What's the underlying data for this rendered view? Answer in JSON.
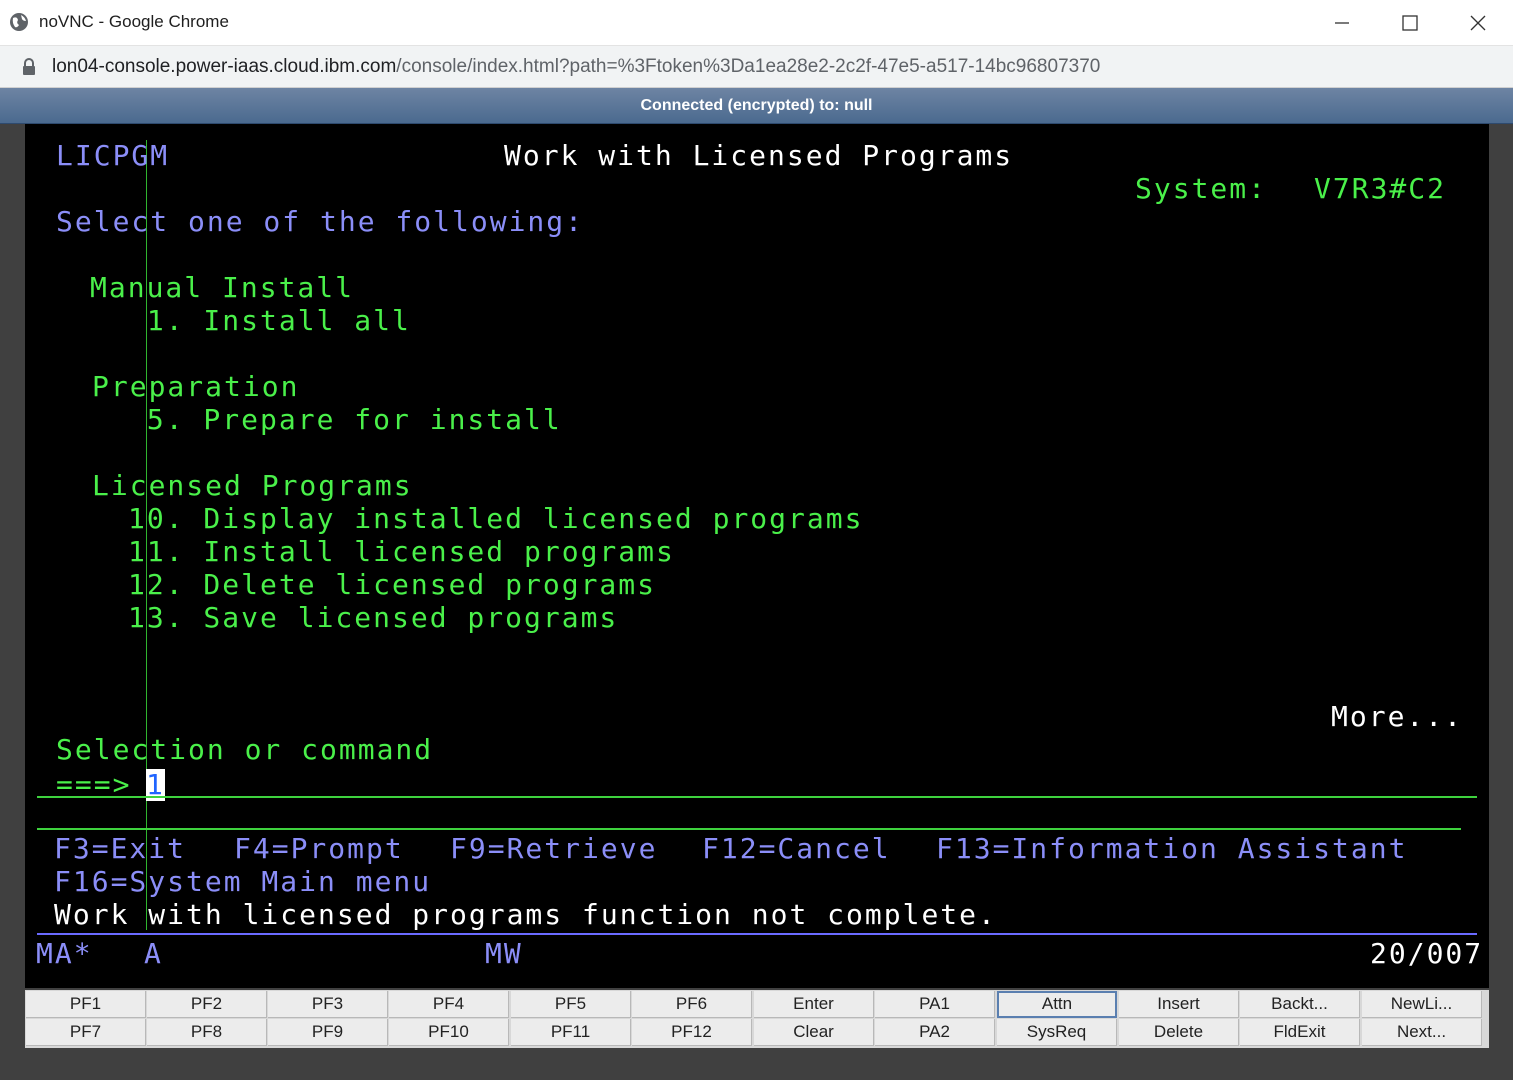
{
  "window": {
    "title": "noVNC - Google Chrome"
  },
  "address": {
    "host": "lon04-console.power-iaas.cloud.ibm.com",
    "path": "/console/index.html?path=%3Ftoken%3Da1ea28e2-2c2f-47e5-a517-14bc96807370"
  },
  "vnc": {
    "status": "Connected (encrypted) to: null"
  },
  "terminal": {
    "program": "LICPGM",
    "title": "Work with Licensed Programs",
    "system_label": "System:",
    "system_value": "V7R3#C2",
    "prompt_header": "Select one of the following:",
    "sections": [
      {
        "heading": "Manual Install",
        "items": [
          " 1. Install all"
        ]
      },
      {
        "heading": "Preparation",
        "items": [
          " 5. Prepare for install"
        ]
      },
      {
        "heading": "Licensed Programs",
        "items": [
          "10. Display installed licensed programs",
          "11. Install licensed programs",
          "12. Delete licensed programs",
          "13. Save licensed programs"
        ]
      }
    ],
    "more": "More...",
    "selection_label": "Selection or command",
    "arrow": "===>",
    "input_value": "1",
    "fkeys_line1": [
      "F3=Exit",
      "F4=Prompt",
      "F9=Retrieve",
      "F12=Cancel",
      "F13=Information Assistant"
    ],
    "fkeys_line2": "F16=System Main menu",
    "message": "Work with licensed programs function not complete.",
    "status": {
      "left": "MA*",
      "a": "A",
      "mid": "MW",
      "right": "20/007"
    }
  },
  "keypad": {
    "row1": [
      "PF1",
      "PF2",
      "PF3",
      "PF4",
      "PF5",
      "PF6",
      "Enter",
      "PA1",
      "Attn",
      "Insert",
      "Backt...",
      "NewLi..."
    ],
    "row2": [
      "PF7",
      "PF8",
      "PF9",
      "PF10",
      "PF11",
      "PF12",
      "Clear",
      "PA2",
      "SysReq",
      "Delete",
      "FldExit",
      "Next..."
    ]
  },
  "colors": {
    "terminal_bg": "#000000",
    "green": "#4af04a",
    "blue": "#8b8ef8",
    "white": "#ffffff"
  }
}
